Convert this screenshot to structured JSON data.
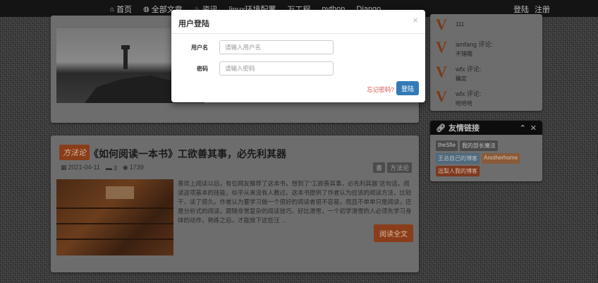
{
  "nav": {
    "items": [
      {
        "icon": "home-icon",
        "glyph": "⌂",
        "label": "首页"
      },
      {
        "icon": "globe-icon",
        "glyph": "◍",
        "label": "全部文章"
      },
      {
        "icon": "flame-icon",
        "glyph": "♨",
        "label": "资讯"
      },
      {
        "icon": "",
        "glyph": "",
        "label": "linux环境配置"
      },
      {
        "icon": "",
        "glyph": "",
        "label": "万工程"
      },
      {
        "icon": "",
        "glyph": "",
        "label": "python"
      },
      {
        "icon": "",
        "glyph": "",
        "label": "Django"
      }
    ],
    "login": "登陆",
    "register": "注册"
  },
  "post": {
    "category": "方法论",
    "title": "《如何阅读一本书》工欲善其事，必先利其器",
    "date": "2021-04-11",
    "comments": "3",
    "views": "1739",
    "tags": [
      "書",
      "方法论"
    ],
    "excerpt": "喜欢上阅读以后，有位网友推荐了这本书，想到了“工欲善其事，必先利其器”这句话，阅读这项基本的技能，似乎从来没有人教过。这本书提供了作者认为应该的阅读方法，比较干、读了很久。作者认为要学习做一个很好的阅读者很不容易，而且不单单只是阅读，还是分析式的阅读，跟随非常复杂的阅读技巧，好比滑雪，一个初学滑雪的人必须先学习身体的动作，熟练之后，才能放下这些汪 ...",
    "read_more": "阅读全文"
  },
  "comments": [
    {
      "avatar": "V",
      "user": "",
      "text": "111"
    },
    {
      "avatar": "V",
      "user": "amfang 评论:",
      "text": "不错哦"
    },
    {
      "avatar": "V",
      "user": "wfx 评论:",
      "text": "确定"
    },
    {
      "avatar": "V",
      "user": "wfx 评论:",
      "text": "哈哈哈"
    }
  ],
  "links": {
    "title": "友情链接",
    "items": [
      {
        "label": "theSfie",
        "style": "gray"
      },
      {
        "label": "我的部长魔法",
        "style": "gray"
      },
      {
        "label": "王总自己的博客",
        "style": "blue"
      },
      {
        "label": "Anotherhome",
        "style": "orange"
      },
      {
        "label": "逗梨人我的博客",
        "style": "red"
      }
    ]
  },
  "modal": {
    "title": "用户登陆",
    "close": "×",
    "username_label": "用户名",
    "username_placeholder": "请输入用户名",
    "password_label": "密码",
    "password_placeholder": "请输入密码",
    "forgot": "忘记密码?",
    "submit": "登陆"
  },
  "colors": {
    "primary": "#337ab7",
    "danger": "#d9534f",
    "accent": "#8a3d1a"
  }
}
